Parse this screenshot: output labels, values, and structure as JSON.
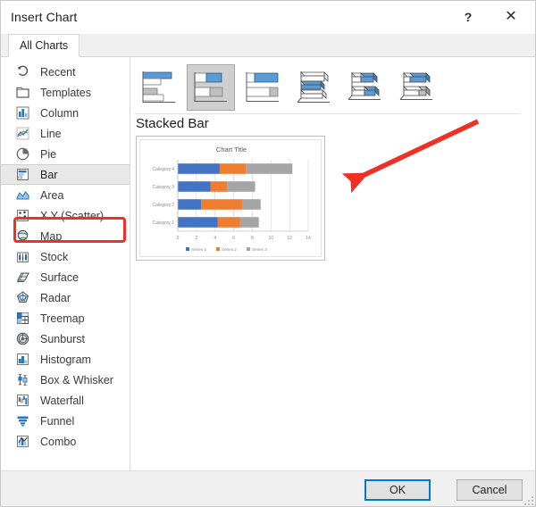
{
  "window": {
    "title": "Insert Chart",
    "help_label": "?",
    "close_label": "✕"
  },
  "tabs": [
    {
      "label": "All Charts",
      "selected": true
    }
  ],
  "sidebar": {
    "items": [
      {
        "label": "Recent",
        "icon": "recent-icon",
        "selected": false
      },
      {
        "label": "Templates",
        "icon": "templates-icon",
        "selected": false
      },
      {
        "label": "Column",
        "icon": "column-icon",
        "selected": false
      },
      {
        "label": "Line",
        "icon": "line-icon",
        "selected": false
      },
      {
        "label": "Pie",
        "icon": "pie-icon",
        "selected": false
      },
      {
        "label": "Bar",
        "icon": "bar-icon",
        "selected": true
      },
      {
        "label": "Area",
        "icon": "area-icon",
        "selected": false
      },
      {
        "label": "X Y (Scatter)",
        "icon": "scatter-icon",
        "selected": false
      },
      {
        "label": "Map",
        "icon": "map-icon",
        "selected": false
      },
      {
        "label": "Stock",
        "icon": "stock-icon",
        "selected": false
      },
      {
        "label": "Surface",
        "icon": "surface-icon",
        "selected": false
      },
      {
        "label": "Radar",
        "icon": "radar-icon",
        "selected": false
      },
      {
        "label": "Treemap",
        "icon": "treemap-icon",
        "selected": false
      },
      {
        "label": "Sunburst",
        "icon": "sunburst-icon",
        "selected": false
      },
      {
        "label": "Histogram",
        "icon": "histogram-icon",
        "selected": false
      },
      {
        "label": "Box & Whisker",
        "icon": "boxwhisker-icon",
        "selected": false
      },
      {
        "label": "Waterfall",
        "icon": "waterfall-icon",
        "selected": false
      },
      {
        "label": "Funnel",
        "icon": "funnel-icon",
        "selected": false
      },
      {
        "label": "Combo",
        "icon": "combo-icon",
        "selected": false
      }
    ]
  },
  "subtypes": [
    {
      "name": "Clustered Bar",
      "icon": "clustered-bar-icon",
      "selected": false
    },
    {
      "name": "Stacked Bar",
      "icon": "stacked-bar-icon",
      "selected": true
    },
    {
      "name": "100% Stacked Bar",
      "icon": "pct-stacked-bar-icon",
      "selected": false
    },
    {
      "name": "3-D Clustered Bar",
      "icon": "bar3d-clustered-icon",
      "selected": false
    },
    {
      "name": "3-D Stacked Bar",
      "icon": "bar3d-stacked-icon",
      "selected": false
    },
    {
      "name": "3-D 100% Stacked Bar",
      "icon": "bar3d-pct-icon",
      "selected": false
    }
  ],
  "preview": {
    "heading": "Stacked Bar"
  },
  "chart_data": {
    "type": "bar",
    "orientation": "horizontal",
    "stacked": true,
    "title": "Chart Title",
    "xlabel": "",
    "ylabel": "",
    "categories": [
      "Category 1",
      "Category 2",
      "Category 3",
      "Category 4"
    ],
    "series": [
      {
        "name": "Series 1",
        "values": [
          4.3,
          2.5,
          3.5,
          4.5
        ],
        "color": "#4472C4"
      },
      {
        "name": "Series 2",
        "values": [
          2.4,
          4.4,
          1.8,
          2.8
        ],
        "color": "#ED7D31"
      },
      {
        "name": "Series 3",
        "values": [
          2.0,
          2.0,
          3.0,
          5.0
        ],
        "color": "#A5A5A5"
      }
    ],
    "xticks": [
      0,
      2,
      4,
      6,
      8,
      10,
      12,
      14
    ],
    "xlim": [
      0,
      14
    ],
    "grid": "vertical",
    "legend_position": "bottom",
    "legend_entries": [
      "Series 1",
      "Series 2",
      "Series 3"
    ]
  },
  "annotation": {
    "arrow_color": "#ee3124",
    "highlight_color": "#ee3124",
    "highlight_target": "Bar"
  },
  "footer": {
    "ok_label": "OK",
    "cancel_label": "Cancel"
  }
}
